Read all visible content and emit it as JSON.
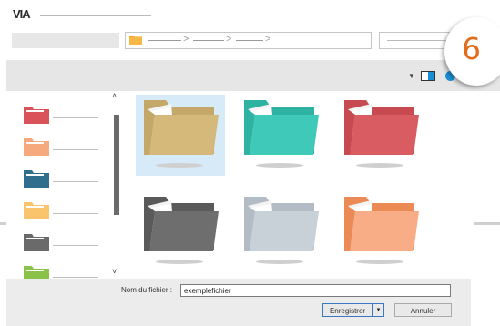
{
  "app": {
    "logo": "VIA"
  },
  "badge": {
    "number": "6",
    "color": "#e06c1c"
  },
  "address_bar": {
    "folder_icon_color": "#f5a623",
    "separators": [
      ">",
      ">",
      ">"
    ]
  },
  "toolbar": {
    "view_icons": [
      "dropdown-caret",
      "pane-view",
      "help"
    ]
  },
  "sidebar": {
    "items": [
      {
        "icon": "folder-icon",
        "color": "#d9525a"
      },
      {
        "icon": "folder-icon",
        "color": "#f7a97e"
      },
      {
        "icon": "folder-icon",
        "color": "#2f6e8c"
      },
      {
        "icon": "folder-icon",
        "color": "#f9c46b"
      },
      {
        "icon": "folder-icon",
        "color": "#6a6a6a"
      },
      {
        "icon": "folder-icon",
        "color": "#8bc34a"
      }
    ]
  },
  "folders": [
    {
      "color": "#d4b97a",
      "tab": "#c4a86a",
      "selected": true
    },
    {
      "color": "#3ec9b8",
      "tab": "#2eb3a3",
      "selected": false
    },
    {
      "color": "#d95c63",
      "tab": "#c84a51",
      "selected": false
    },
    {
      "color": "#6e6e6e",
      "tab": "#5a5a5a",
      "selected": false
    },
    {
      "color": "#c9d1d8",
      "tab": "#b3bcc4",
      "selected": false
    },
    {
      "color": "#f8ad87",
      "tab": "#ec8a55",
      "selected": false
    }
  ],
  "footer": {
    "filename_label": "Nom du fichier :",
    "filename_value": "exemplefichier",
    "save_label": "Enregistrer",
    "save_dropdown": "▾",
    "cancel_label": "Annuler"
  }
}
